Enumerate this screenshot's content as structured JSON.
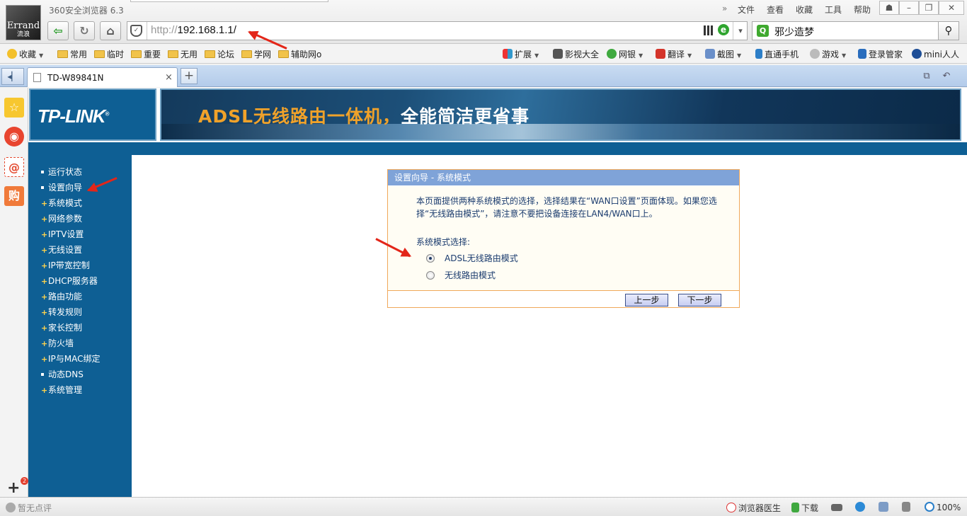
{
  "browser": {
    "app_title": "360安全浏览器 6.3",
    "logo_text": "Errand",
    "logo_subtext": "流浪",
    "menu": [
      "文件",
      "查看",
      "收藏",
      "工具",
      "帮助"
    ],
    "url_scheme": "http://",
    "url_host": "192.168.1.1/",
    "search_text": "邪少造梦"
  },
  "bookmarks": {
    "left": [
      "收藏",
      "常用",
      "临时",
      "重要",
      "无用",
      "论坛",
      "学网",
      "辅助网o"
    ],
    "right": [
      "扩展",
      "影视大全",
      "网银",
      "翻译",
      "截图",
      "直通手机",
      "游戏",
      "登录管家",
      "mini人人"
    ]
  },
  "tab": {
    "title": "TD-W89841N",
    "close": "×",
    "new": "+"
  },
  "router": {
    "logo": "TP-LINK",
    "banner_part1": "ADSL无线路由一体机，",
    "banner_part2": "全能简洁更省事",
    "menu": [
      {
        "label": "运行状态",
        "kind": "dot"
      },
      {
        "label": "设置向导",
        "kind": "dot"
      },
      {
        "label": "系统模式",
        "kind": "plus"
      },
      {
        "label": "网络参数",
        "kind": "plus"
      },
      {
        "label": "IPTV设置",
        "kind": "plus"
      },
      {
        "label": "无线设置",
        "kind": "plus"
      },
      {
        "label": "IP带宽控制",
        "kind": "plus"
      },
      {
        "label": "DHCP服务器",
        "kind": "plus"
      },
      {
        "label": "路由功能",
        "kind": "plus"
      },
      {
        "label": "转发规则",
        "kind": "plus"
      },
      {
        "label": "家长控制",
        "kind": "plus"
      },
      {
        "label": "防火墙",
        "kind": "plus"
      },
      {
        "label": "IP与MAC绑定",
        "kind": "plus"
      },
      {
        "label": "动态DNS",
        "kind": "dot"
      },
      {
        "label": "系统管理",
        "kind": "plus"
      }
    ],
    "panel": {
      "title": "设置向导 - 系统模式",
      "desc_line1": "本页面提供两种系统模式的选择，选择结果在“WAN口设置”页面体现。如果您选",
      "desc_line2": "择“无线路由模式”，请注意不要把设备连接在LAN4/WAN口上。",
      "mode_label": "系统模式选择:",
      "option1": "ADSL无线路由模式",
      "option2": "无线路由模式",
      "selected": "ADSL无线路由模式",
      "prev": "上一步",
      "next": "下一步"
    }
  },
  "sidebar": {
    "badge": "2"
  },
  "status": {
    "left": "暂无点评",
    "doctor": "浏览器医生",
    "download": "下载",
    "zoom": "100%"
  },
  "colors": {
    "router_blue": "#0e5f94",
    "panel_head": "#7fa3d8",
    "panel_border": "#f0a85a",
    "arrow_red": "#e32619"
  }
}
